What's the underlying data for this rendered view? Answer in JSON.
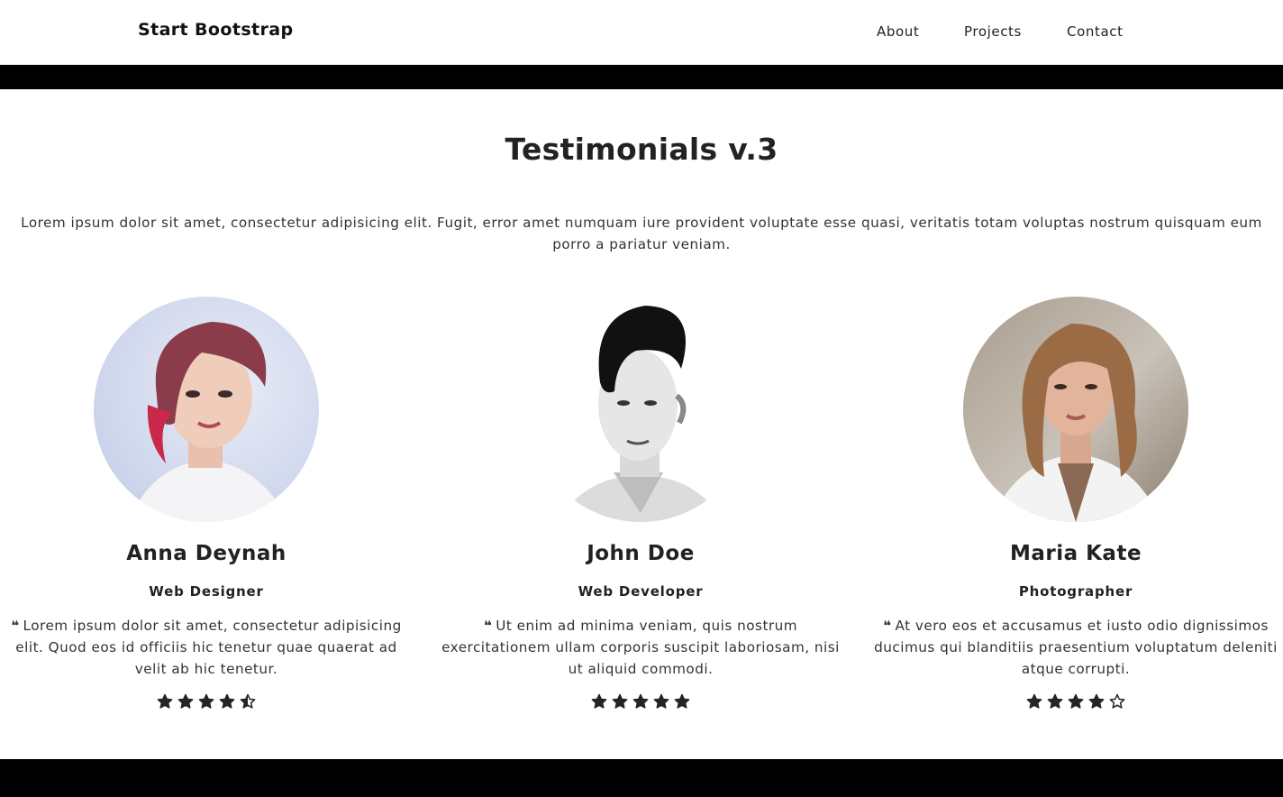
{
  "navbar": {
    "brand": "Start Bootstrap",
    "links": [
      "About",
      "Projects",
      "Contact"
    ]
  },
  "section": {
    "title": "Testimonials v.3",
    "intro": "Lorem ipsum dolor sit amet, consectetur adipisicing elit. Fugit, error amet numquam iure provident voluptate esse quasi, veritatis totam voluptas nostrum quisquam eum porro a pariatur veniam."
  },
  "testimonials": [
    {
      "name": "Anna Deynah",
      "role": "Web Designer",
      "quote_icon": "quote-left-icon",
      "quote": "Lorem ipsum dolor sit amet, consectetur adipisicing elit. Quod eos id officiis hic tenetur quae quaerat ad velit ab hic tenetur.",
      "rating": 4.5
    },
    {
      "name": "John Doe",
      "role": "Web Developer",
      "quote_icon": "quote-left-icon",
      "quote": "Ut enim ad minima veniam, quis nostrum exercitationem ullam corporis suscipit laboriosam, nisi ut aliquid commodi.",
      "rating": 5
    },
    {
      "name": "Maria Kate",
      "role": "Photographer",
      "quote_icon": "quote-left-icon",
      "quote": "At vero eos et accusamus et iusto odio dignissimos ducimus qui blanditiis praesentium voluptatum deleniti atque corrupti.",
      "rating": 4
    }
  ],
  "colors": {
    "text": "#212529",
    "bars": "#000000",
    "star": "#212529"
  }
}
